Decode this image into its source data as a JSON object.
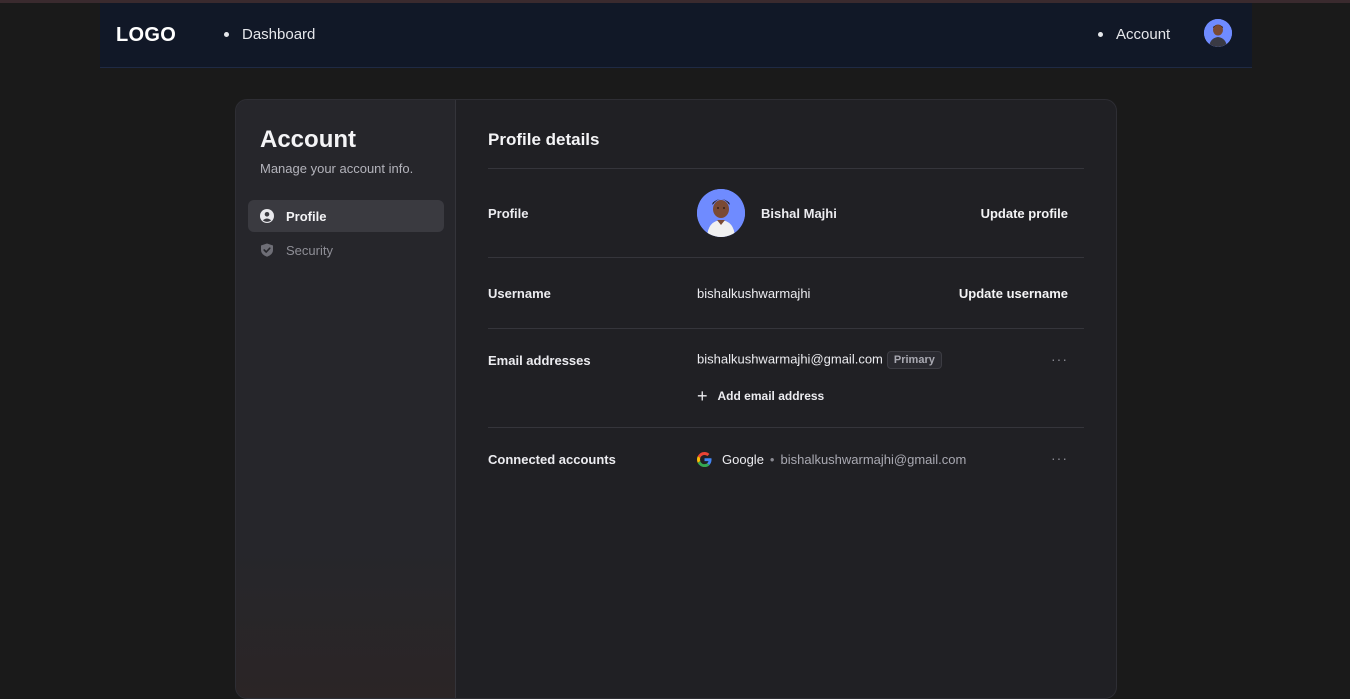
{
  "navbar": {
    "logo": "LOGO",
    "links": [
      "Dashboard",
      "Account"
    ]
  },
  "sidebar": {
    "title": "Account",
    "subtitle": "Manage your account info.",
    "items": [
      {
        "label": "Profile",
        "icon": "user-circle-icon",
        "active": true
      },
      {
        "label": "Security",
        "icon": "shield-check-icon",
        "active": false
      }
    ]
  },
  "main": {
    "title": "Profile details",
    "profile": {
      "label": "Profile",
      "name": "Bishal Majhi",
      "action": "Update profile"
    },
    "username": {
      "label": "Username",
      "value": "bishalkushwarmajhi",
      "action": "Update username"
    },
    "emails": {
      "label": "Email addresses",
      "primary_email": "bishalkushwarmajhi@gmail.com",
      "badge": "Primary",
      "add_label": "Add email address"
    },
    "connected": {
      "label": "Connected accounts",
      "provider": "Google",
      "separator": "•",
      "email": "bishalkushwarmajhi@gmail.com"
    }
  },
  "colors": {
    "page_bg": "#1a1a1a",
    "navbar_bg": "#111827",
    "card_bg": "#202024",
    "avatar_bg": "#6f8bff"
  }
}
